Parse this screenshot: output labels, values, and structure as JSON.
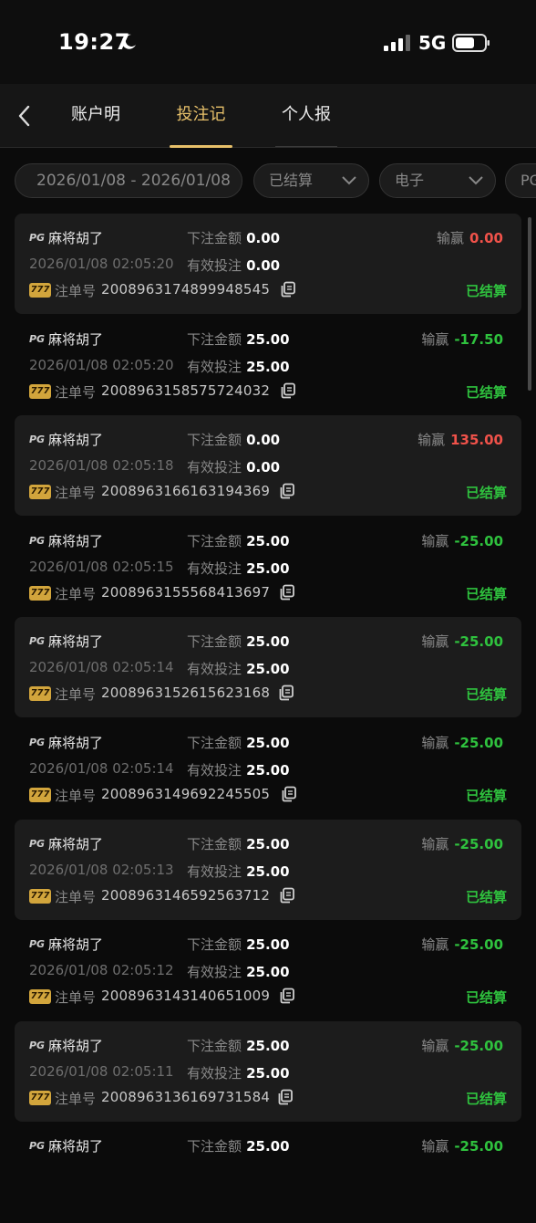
{
  "status": {
    "time": "19:27",
    "network": "5G"
  },
  "nav": {
    "tabs": [
      "账户明细",
      "投注记录",
      "个人报表"
    ]
  },
  "filters": {
    "date_range": "2026/01/08 - 2026/01/08",
    "status": "已结算",
    "category": "电子",
    "platform": "PG"
  },
  "labels": {
    "bet_amount": "下注金额",
    "valid_bet": "有效投注",
    "order_no": "注单号",
    "win_loss": "输赢",
    "pg": "PG",
    "logo777": "777"
  },
  "records": [
    {
      "game": "麻将胡了",
      "bet": "0.00",
      "valid": "0.00",
      "time": "2026/01/08 02:05:20",
      "order": "2008963174899948545",
      "winloss": "0.00",
      "winloss_color": "red",
      "status": "已结算"
    },
    {
      "game": "麻将胡了",
      "bet": "25.00",
      "valid": "25.00",
      "time": "2026/01/08 02:05:20",
      "order": "2008963158575724032",
      "winloss": "-17.50",
      "winloss_color": "green",
      "status": "已结算"
    },
    {
      "game": "麻将胡了",
      "bet": "0.00",
      "valid": "0.00",
      "time": "2026/01/08 02:05:18",
      "order": "2008963166163194369",
      "winloss": "135.00",
      "winloss_color": "red",
      "status": "已结算"
    },
    {
      "game": "麻将胡了",
      "bet": "25.00",
      "valid": "25.00",
      "time": "2026/01/08 02:05:15",
      "order": "2008963155568413697",
      "winloss": "-25.00",
      "winloss_color": "green",
      "status": "已结算"
    },
    {
      "game": "麻将胡了",
      "bet": "25.00",
      "valid": "25.00",
      "time": "2026/01/08 02:05:14",
      "order": "2008963152615623168",
      "winloss": "-25.00",
      "winloss_color": "green",
      "status": "已结算"
    },
    {
      "game": "麻将胡了",
      "bet": "25.00",
      "valid": "25.00",
      "time": "2026/01/08 02:05:14",
      "order": "2008963149692245505",
      "winloss": "-25.00",
      "winloss_color": "green",
      "status": "已结算"
    },
    {
      "game": "麻将胡了",
      "bet": "25.00",
      "valid": "25.00",
      "time": "2026/01/08 02:05:13",
      "order": "2008963146592563712",
      "winloss": "-25.00",
      "winloss_color": "green",
      "status": "已结算"
    },
    {
      "game": "麻将胡了",
      "bet": "25.00",
      "valid": "25.00",
      "time": "2026/01/08 02:05:12",
      "order": "2008963143140651009",
      "winloss": "-25.00",
      "winloss_color": "green",
      "status": "已结算"
    },
    {
      "game": "麻将胡了",
      "bet": "25.00",
      "valid": "25.00",
      "time": "2026/01/08 02:05:11",
      "order": "2008963136169731584",
      "winloss": "-25.00",
      "winloss_color": "green",
      "status": "已结算"
    },
    {
      "game": "麻将胡了",
      "bet": "25.00",
      "valid": "",
      "time": "",
      "order": "",
      "winloss": "-25.00",
      "winloss_color": "green",
      "status": ""
    }
  ]
}
